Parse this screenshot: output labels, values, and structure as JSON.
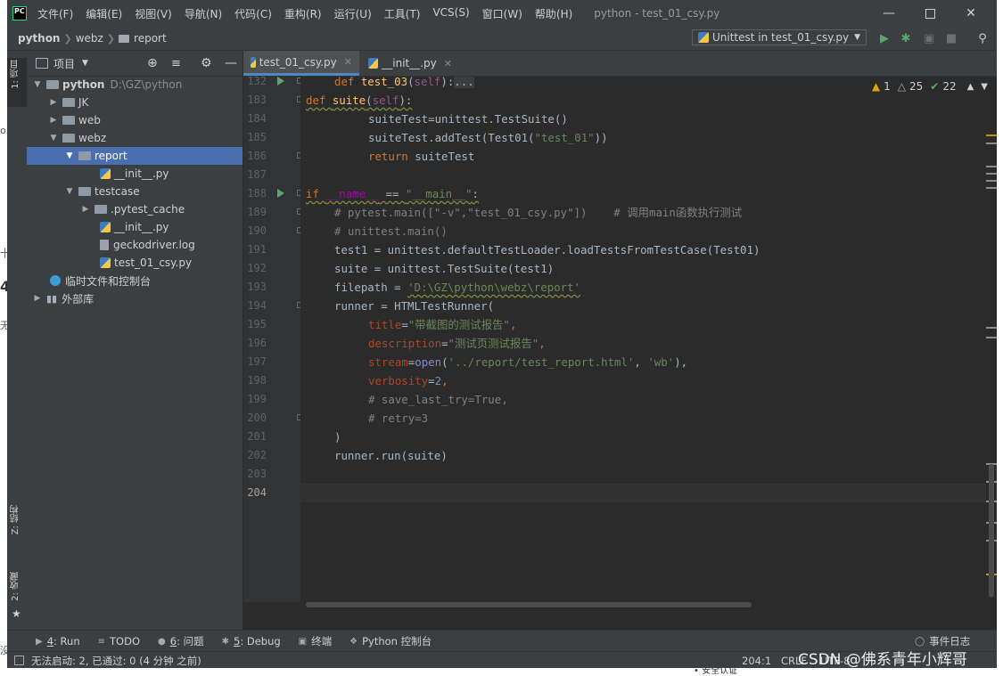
{
  "app": {
    "logo": "PC",
    "window_title": "python - test_01_csy.py"
  },
  "menu": [
    "文件(F)",
    "编辑(E)",
    "视图(V)",
    "导航(N)",
    "代码(C)",
    "重构(R)",
    "运行(U)",
    "工具(T)",
    "VCS(S)",
    "窗口(W)",
    "帮助(H)"
  ],
  "breadcrumbs": [
    "python",
    "webz",
    "report"
  ],
  "run_config": {
    "label": "Unittest in test_01_csy.py"
  },
  "left_strip": {
    "project": "1: 项目",
    "structure": "Z: 结构",
    "favorites": "2: 收藏"
  },
  "project_panel": {
    "title": "项目",
    "tree": [
      {
        "label": "python",
        "path_hint": "D:\\GZ\\python",
        "type": "folder",
        "depth": 0,
        "expanded": true
      },
      {
        "label": "JK",
        "type": "folder",
        "depth": 1,
        "expanded": false
      },
      {
        "label": "web",
        "type": "folder",
        "depth": 1,
        "expanded": false
      },
      {
        "label": "webz",
        "type": "folder",
        "depth": 1,
        "expanded": true
      },
      {
        "label": "report",
        "type": "folder",
        "depth": 2,
        "expanded": true,
        "selected": true
      },
      {
        "label": "__init__.py",
        "type": "py",
        "depth": 3
      },
      {
        "label": "testcase",
        "type": "folder",
        "depth": 2,
        "expanded": true
      },
      {
        "label": ".pytest_cache",
        "type": "folder",
        "depth": 3,
        "expanded": false
      },
      {
        "label": "__init__.py",
        "type": "py",
        "depth": 3
      },
      {
        "label": "geckodriver.log",
        "type": "log",
        "depth": 3
      },
      {
        "label": "test_01_csy.py",
        "type": "py",
        "depth": 3
      },
      {
        "label": "临时文件和控制台",
        "type": "scratch",
        "depth": 1
      },
      {
        "label": "外部库",
        "type": "lib",
        "depth": 0,
        "expanded": false
      }
    ]
  },
  "tabs": [
    {
      "label": "test_01_csy.py",
      "active": true
    },
    {
      "label": "__init__.py",
      "active": false
    }
  ],
  "inspections": {
    "warnings": "1",
    "weak_warnings": "25",
    "ok": "22"
  },
  "editor": {
    "lines": [
      {
        "n": "132"
      },
      {
        "n": "183"
      },
      {
        "n": "184"
      },
      {
        "n": "185"
      },
      {
        "n": "186"
      },
      {
        "n": "187"
      },
      {
        "n": "188"
      },
      {
        "n": "189"
      },
      {
        "n": "190"
      },
      {
        "n": "191"
      },
      {
        "n": "192"
      },
      {
        "n": "193"
      },
      {
        "n": "194"
      },
      {
        "n": "195"
      },
      {
        "n": "196"
      },
      {
        "n": "197"
      },
      {
        "n": "198"
      },
      {
        "n": "199"
      },
      {
        "n": "200"
      },
      {
        "n": "201"
      },
      {
        "n": "202"
      },
      {
        "n": "203"
      },
      {
        "n": "204"
      }
    ],
    "code": {
      "l132_def": "def ",
      "l132_name": "test_03",
      "l132_open": "(",
      "l132_self": "self",
      "l132_close": "):",
      "l132_fold": "...",
      "l183_def": "def ",
      "l183_name": "suite",
      "l183_open": "(",
      "l183_self": "self",
      "l183_close": "):",
      "l184": "suiteTest=unittest.TestSuite()",
      "l185_a": "suiteTest.addTest(Test01(",
      "l185_str": "\"test_01\"",
      "l185_b": "))",
      "l186_kw": "return ",
      "l186_rest": "suiteTest",
      "l188_if": "if ",
      "l188_name": "__name__",
      "l188_eq": " == ",
      "l188_str": "\"__main__\"",
      "l188_colon": ":",
      "l189": "# pytest.main([\"-v\",\"test_01_csy.py\"])    # 调用main函数执行测试",
      "l190": "# unittest.main()",
      "l191": "test1 = unittest.defaultTestLoader.loadTestsFromTestCase(Test01)",
      "l192": "suite = unittest.TestSuite(test1)",
      "l193_a": "filepath = ",
      "l193_str": "'D:\\GZ\\python\\webz\\report'",
      "l194": "runner = HTMLTestRunner(",
      "l195_p": "title",
      "l195_eq": "=",
      "l195_str": "\"带截图的测试报告\"",
      "l195_c": ",",
      "l196_p": "description",
      "l196_eq": "=",
      "l196_str": "\"测试页测试报告\"",
      "l196_c": ",",
      "l197_p": "stream",
      "l197_eq": "=",
      "l197_fn": "open",
      "l197_o": "(",
      "l197_s1": "'../report/test_report.html'",
      "l197_m": ", ",
      "l197_s2": "'wb'",
      "l197_e": "),",
      "l198_p": "verbosity",
      "l198_eq": "=",
      "l198_num": "2",
      "l198_c": ",",
      "l199": "# save_last_try=True,",
      "l200": "# retry=3",
      "l201": ")",
      "l202": "runner.run(suite)"
    }
  },
  "tool_windows": [
    {
      "num": "4",
      "label": ": Run",
      "icon": "play-icon"
    },
    {
      "num": "",
      "label": "TODO",
      "icon": "todo-icon"
    },
    {
      "num": "6",
      "label": ": 问题",
      "icon": "problems-icon"
    },
    {
      "num": "5",
      "label": ": Debug",
      "icon": "debug-icon"
    },
    {
      "num": "",
      "label": "终端",
      "icon": "terminal-icon"
    },
    {
      "num": "",
      "label": "Python 控制台",
      "icon": "python-console-icon"
    }
  ],
  "event_log": "事件日志",
  "status": {
    "message": "无法启动: 2, 已通过: 0 (4 分钟 之前)",
    "position": "204:1",
    "line_sep": "CRLF",
    "encoding": "UTF-8"
  },
  "watermark": "CSDN @佛系青年小辉哥",
  "edge_fragments": [
    "o",
    "十",
    "4",
    "无",
    "没",
    "• 安全认证"
  ]
}
